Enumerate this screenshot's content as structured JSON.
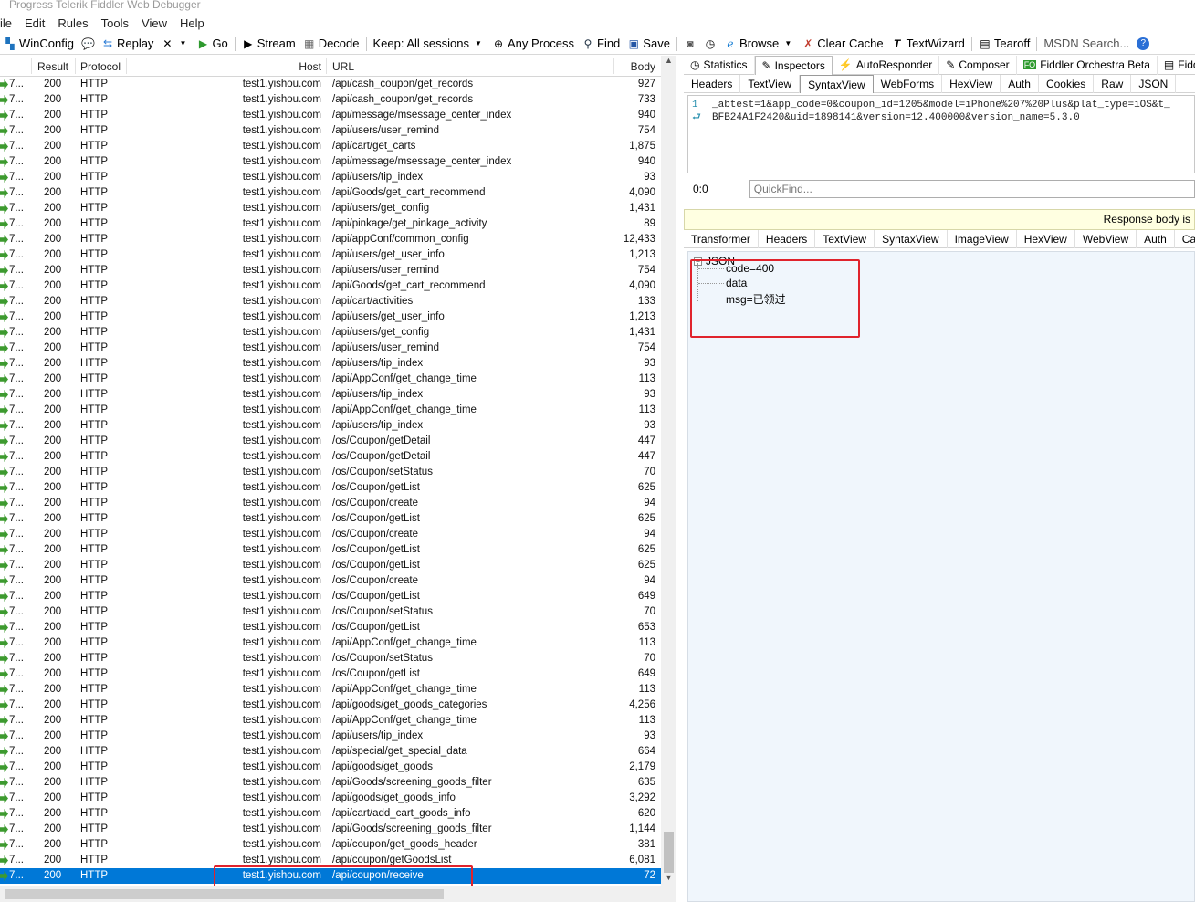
{
  "window": {
    "title": "Progress Telerik Fiddler Web Debugger"
  },
  "menu": [
    "ile",
    "Edit",
    "Rules",
    "Tools",
    "View",
    "Help"
  ],
  "toolbar": {
    "winconfig": "WinConfig",
    "replay": "Replay",
    "go": "Go",
    "stream": "Stream",
    "decode": "Decode",
    "keep": "Keep: All sessions",
    "any_process": "Any Process",
    "find": "Find",
    "save": "Save",
    "browse": "Browse",
    "clear_cache": "Clear Cache",
    "textwizard": "TextWizard",
    "tearoff": "Tearoff",
    "msdn": "MSDN Search..."
  },
  "sessions": {
    "headers": {
      "result": "Result",
      "protocol": "Protocol",
      "host": "Host",
      "url": "URL",
      "body": "Body"
    },
    "rows": [
      {
        "id": "7...",
        "result": "200",
        "protocol": "HTTP",
        "host": "test1.yishou.com",
        "url": "/api/cash_coupon/get_records",
        "body": "927"
      },
      {
        "id": "7...",
        "result": "200",
        "protocol": "HTTP",
        "host": "test1.yishou.com",
        "url": "/api/cash_coupon/get_records",
        "body": "733"
      },
      {
        "id": "7...",
        "result": "200",
        "protocol": "HTTP",
        "host": "test1.yishou.com",
        "url": "/api/message/msessage_center_index",
        "body": "940"
      },
      {
        "id": "7...",
        "result": "200",
        "protocol": "HTTP",
        "host": "test1.yishou.com",
        "url": "/api/users/user_remind",
        "body": "754"
      },
      {
        "id": "7...",
        "result": "200",
        "protocol": "HTTP",
        "host": "test1.yishou.com",
        "url": "/api/cart/get_carts",
        "body": "1,875"
      },
      {
        "id": "7...",
        "result": "200",
        "protocol": "HTTP",
        "host": "test1.yishou.com",
        "url": "/api/message/msessage_center_index",
        "body": "940"
      },
      {
        "id": "7...",
        "result": "200",
        "protocol": "HTTP",
        "host": "test1.yishou.com",
        "url": "/api/users/tip_index",
        "body": "93"
      },
      {
        "id": "7...",
        "result": "200",
        "protocol": "HTTP",
        "host": "test1.yishou.com",
        "url": "/api/Goods/get_cart_recommend",
        "body": "4,090"
      },
      {
        "id": "7...",
        "result": "200",
        "protocol": "HTTP",
        "host": "test1.yishou.com",
        "url": "/api/users/get_config",
        "body": "1,431"
      },
      {
        "id": "7...",
        "result": "200",
        "protocol": "HTTP",
        "host": "test1.yishou.com",
        "url": "/api/pinkage/get_pinkage_activity",
        "body": "89"
      },
      {
        "id": "7...",
        "result": "200",
        "protocol": "HTTP",
        "host": "test1.yishou.com",
        "url": "/api/appConf/common_config",
        "body": "12,433"
      },
      {
        "id": "7...",
        "result": "200",
        "protocol": "HTTP",
        "host": "test1.yishou.com",
        "url": "/api/users/get_user_info",
        "body": "1,213"
      },
      {
        "id": "7...",
        "result": "200",
        "protocol": "HTTP",
        "host": "test1.yishou.com",
        "url": "/api/users/user_remind",
        "body": "754"
      },
      {
        "id": "7...",
        "result": "200",
        "protocol": "HTTP",
        "host": "test1.yishou.com",
        "url": "/api/Goods/get_cart_recommend",
        "body": "4,090"
      },
      {
        "id": "7...",
        "result": "200",
        "protocol": "HTTP",
        "host": "test1.yishou.com",
        "url": "/api/cart/activities",
        "body": "133"
      },
      {
        "id": "7...",
        "result": "200",
        "protocol": "HTTP",
        "host": "test1.yishou.com",
        "url": "/api/users/get_user_info",
        "body": "1,213"
      },
      {
        "id": "7...",
        "result": "200",
        "protocol": "HTTP",
        "host": "test1.yishou.com",
        "url": "/api/users/get_config",
        "body": "1,431"
      },
      {
        "id": "7...",
        "result": "200",
        "protocol": "HTTP",
        "host": "test1.yishou.com",
        "url": "/api/users/user_remind",
        "body": "754"
      },
      {
        "id": "7...",
        "result": "200",
        "protocol": "HTTP",
        "host": "test1.yishou.com",
        "url": "/api/users/tip_index",
        "body": "93"
      },
      {
        "id": "7...",
        "result": "200",
        "protocol": "HTTP",
        "host": "test1.yishou.com",
        "url": "/api/AppConf/get_change_time",
        "body": "113"
      },
      {
        "id": "7...",
        "result": "200",
        "protocol": "HTTP",
        "host": "test1.yishou.com",
        "url": "/api/users/tip_index",
        "body": "93"
      },
      {
        "id": "7...",
        "result": "200",
        "protocol": "HTTP",
        "host": "test1.yishou.com",
        "url": "/api/AppConf/get_change_time",
        "body": "113"
      },
      {
        "id": "7...",
        "result": "200",
        "protocol": "HTTP",
        "host": "test1.yishou.com",
        "url": "/api/users/tip_index",
        "body": "93"
      },
      {
        "id": "7...",
        "result": "200",
        "protocol": "HTTP",
        "host": "test1.yishou.com",
        "url": "/os/Coupon/getDetail",
        "body": "447"
      },
      {
        "id": "7...",
        "result": "200",
        "protocol": "HTTP",
        "host": "test1.yishou.com",
        "url": "/os/Coupon/getDetail",
        "body": "447"
      },
      {
        "id": "7...",
        "result": "200",
        "protocol": "HTTP",
        "host": "test1.yishou.com",
        "url": "/os/Coupon/setStatus",
        "body": "70"
      },
      {
        "id": "7...",
        "result": "200",
        "protocol": "HTTP",
        "host": "test1.yishou.com",
        "url": "/os/Coupon/getList",
        "body": "625"
      },
      {
        "id": "7...",
        "result": "200",
        "protocol": "HTTP",
        "host": "test1.yishou.com",
        "url": "/os/Coupon/create",
        "body": "94"
      },
      {
        "id": "7...",
        "result": "200",
        "protocol": "HTTP",
        "host": "test1.yishou.com",
        "url": "/os/Coupon/getList",
        "body": "625"
      },
      {
        "id": "7...",
        "result": "200",
        "protocol": "HTTP",
        "host": "test1.yishou.com",
        "url": "/os/Coupon/create",
        "body": "94"
      },
      {
        "id": "7...",
        "result": "200",
        "protocol": "HTTP",
        "host": "test1.yishou.com",
        "url": "/os/Coupon/getList",
        "body": "625"
      },
      {
        "id": "7...",
        "result": "200",
        "protocol": "HTTP",
        "host": "test1.yishou.com",
        "url": "/os/Coupon/getList",
        "body": "625"
      },
      {
        "id": "7...",
        "result": "200",
        "protocol": "HTTP",
        "host": "test1.yishou.com",
        "url": "/os/Coupon/create",
        "body": "94"
      },
      {
        "id": "7...",
        "result": "200",
        "protocol": "HTTP",
        "host": "test1.yishou.com",
        "url": "/os/Coupon/getList",
        "body": "649"
      },
      {
        "id": "7...",
        "result": "200",
        "protocol": "HTTP",
        "host": "test1.yishou.com",
        "url": "/os/Coupon/setStatus",
        "body": "70"
      },
      {
        "id": "7...",
        "result": "200",
        "protocol": "HTTP",
        "host": "test1.yishou.com",
        "url": "/os/Coupon/getList",
        "body": "653"
      },
      {
        "id": "7...",
        "result": "200",
        "protocol": "HTTP",
        "host": "test1.yishou.com",
        "url": "/api/AppConf/get_change_time",
        "body": "113"
      },
      {
        "id": "7...",
        "result": "200",
        "protocol": "HTTP",
        "host": "test1.yishou.com",
        "url": "/os/Coupon/setStatus",
        "body": "70"
      },
      {
        "id": "7...",
        "result": "200",
        "protocol": "HTTP",
        "host": "test1.yishou.com",
        "url": "/os/Coupon/getList",
        "body": "649"
      },
      {
        "id": "7...",
        "result": "200",
        "protocol": "HTTP",
        "host": "test1.yishou.com",
        "url": "/api/AppConf/get_change_time",
        "body": "113"
      },
      {
        "id": "7...",
        "result": "200",
        "protocol": "HTTP",
        "host": "test1.yishou.com",
        "url": "/api/goods/get_goods_categories",
        "body": "4,256"
      },
      {
        "id": "7...",
        "result": "200",
        "protocol": "HTTP",
        "host": "test1.yishou.com",
        "url": "/api/AppConf/get_change_time",
        "body": "113"
      },
      {
        "id": "7...",
        "result": "200",
        "protocol": "HTTP",
        "host": "test1.yishou.com",
        "url": "/api/users/tip_index",
        "body": "93"
      },
      {
        "id": "7...",
        "result": "200",
        "protocol": "HTTP",
        "host": "test1.yishou.com",
        "url": "/api/special/get_special_data",
        "body": "664"
      },
      {
        "id": "7...",
        "result": "200",
        "protocol": "HTTP",
        "host": "test1.yishou.com",
        "url": "/api/goods/get_goods",
        "body": "2,179"
      },
      {
        "id": "7...",
        "result": "200",
        "protocol": "HTTP",
        "host": "test1.yishou.com",
        "url": "/api/Goods/screening_goods_filter",
        "body": "635"
      },
      {
        "id": "7...",
        "result": "200",
        "protocol": "HTTP",
        "host": "test1.yishou.com",
        "url": "/api/goods/get_goods_info",
        "body": "3,292"
      },
      {
        "id": "7...",
        "result": "200",
        "protocol": "HTTP",
        "host": "test1.yishou.com",
        "url": "/api/cart/add_cart_goods_info",
        "body": "620"
      },
      {
        "id": "7...",
        "result": "200",
        "protocol": "HTTP",
        "host": "test1.yishou.com",
        "url": "/api/Goods/screening_goods_filter",
        "body": "1,144"
      },
      {
        "id": "7...",
        "result": "200",
        "protocol": "HTTP",
        "host": "test1.yishou.com",
        "url": "/api/coupon/get_goods_header",
        "body": "381"
      },
      {
        "id": "7...",
        "result": "200",
        "protocol": "HTTP",
        "host": "test1.yishou.com",
        "url": "/api/coupon/getGoodsList",
        "body": "6,081"
      },
      {
        "id": "7...",
        "result": "200",
        "protocol": "HTTP",
        "host": "test1.yishou.com",
        "url": "/api/coupon/receive",
        "body": "72",
        "selected": true
      }
    ]
  },
  "inspector": {
    "main_tabs": [
      "Statistics",
      "Inspectors",
      "AutoResponder",
      "Composer",
      "Fiddler Orchestra Beta",
      "FiddlerSc"
    ],
    "request_tabs": [
      "Headers",
      "TextView",
      "SyntaxView",
      "WebForms",
      "HexView",
      "Auth",
      "Cookies",
      "Raw",
      "JSON"
    ],
    "request_gutter": "1",
    "request_body_line1": "_abtest=1&app_code=0&coupon_id=1205&model=iPhone%207%20Plus&plat_type=iOS&t_",
    "request_body_line2": "BFB24A1F2420&uid=1898141&version=12.400000&version_name=5.3.0",
    "position": "0:0",
    "quickfind_placeholder": "QuickFind...",
    "response_notice": "Response body is",
    "response_tabs": [
      "Transformer",
      "Headers",
      "TextView",
      "SyntaxView",
      "ImageView",
      "HexView",
      "WebView",
      "Auth",
      "Ca"
    ],
    "json_root": "JSON",
    "json_nodes": [
      "code=400",
      "data",
      "msg=已领过"
    ]
  },
  "colors": {
    "selection": "#0078d7",
    "highlight_box": "#e0232c"
  }
}
